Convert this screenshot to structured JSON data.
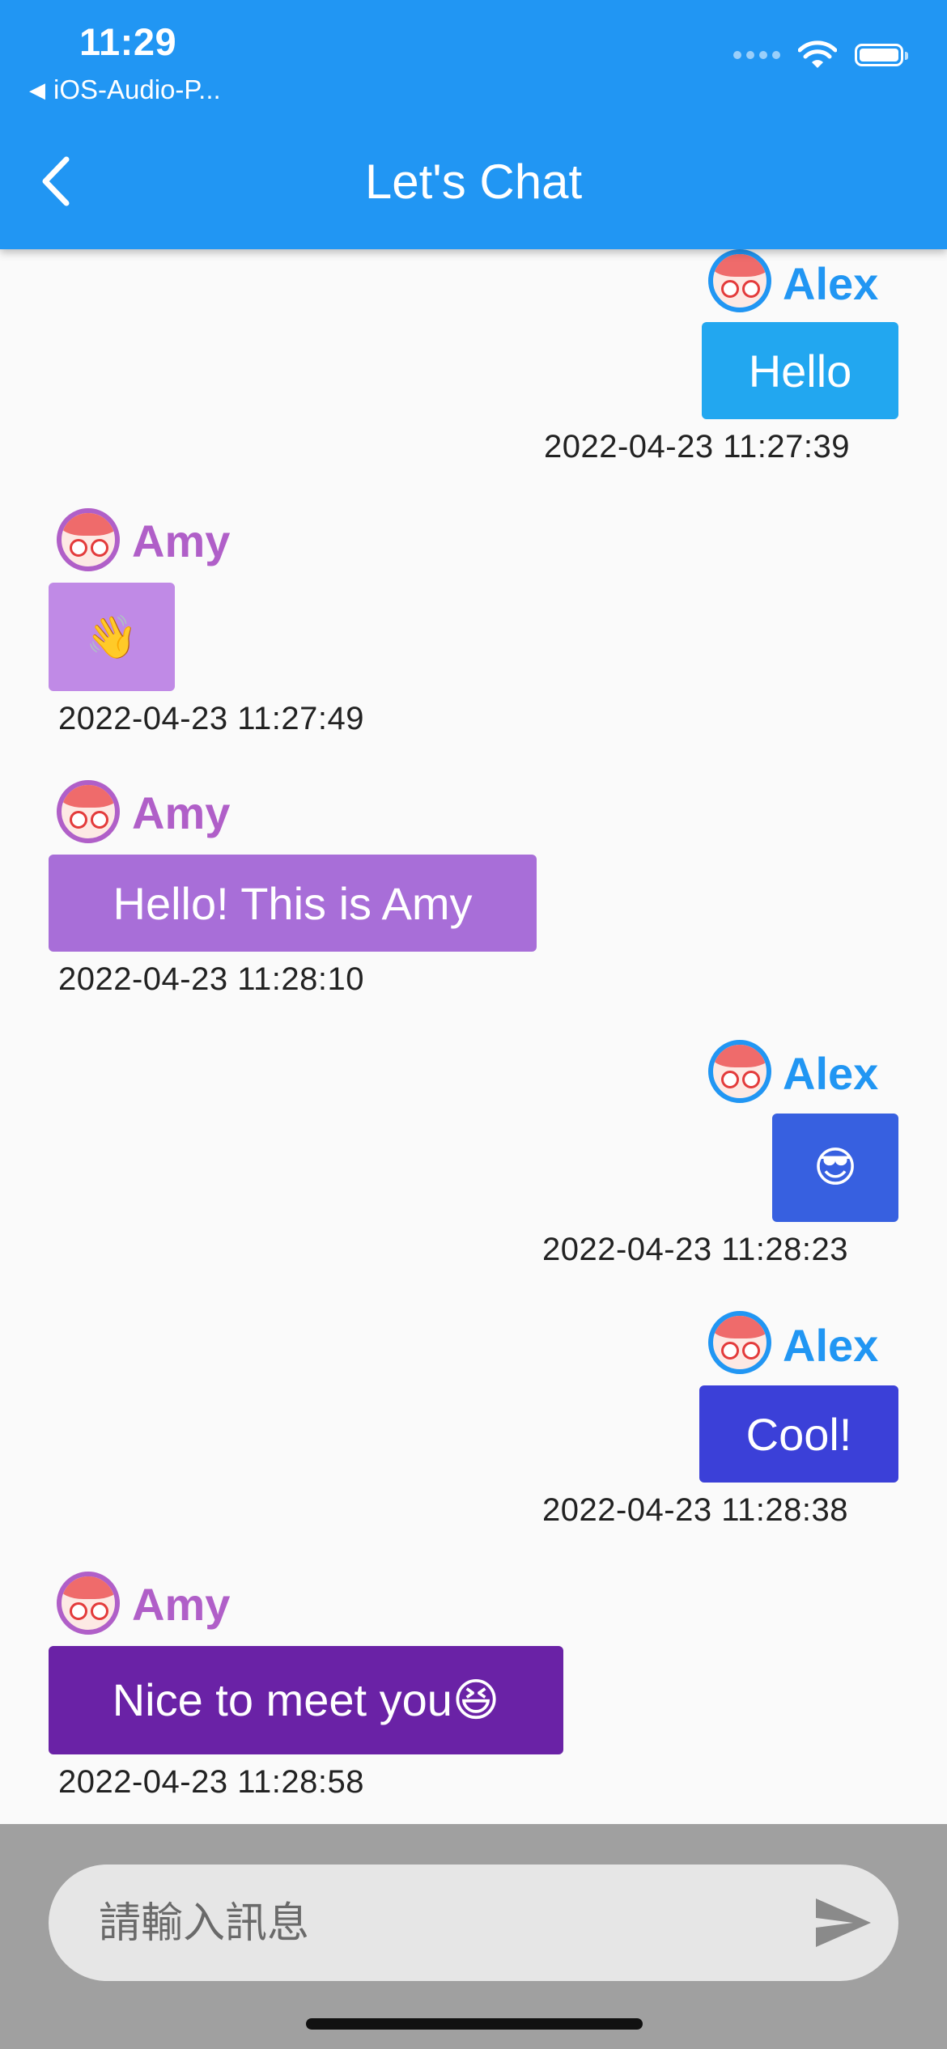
{
  "status_bar": {
    "time": "11:29",
    "back_app": "iOS-Audio-P..."
  },
  "header": {
    "title": "Let's Chat"
  },
  "colors": {
    "appbar": "#2196f3",
    "alex": "#2196f3",
    "amy": "#b05fc8"
  },
  "messages": [
    {
      "sender": "Alex",
      "text": "Hello",
      "timestamp": "2022-04-23 11:27:39",
      "bubble_color": "#22a7f0"
    },
    {
      "sender": "Amy",
      "text": "👋",
      "timestamp": "2022-04-23 11:27:49",
      "bubble_color": "#c08ae6"
    },
    {
      "sender": "Amy",
      "text": "Hello! This is Amy",
      "timestamp": "2022-04-23 11:28:10",
      "bubble_color": "#a86ed8"
    },
    {
      "sender": "Alex",
      "text": "😎",
      "timestamp": "2022-04-23 11:28:23",
      "bubble_color": "#3760e0"
    },
    {
      "sender": "Alex",
      "text": "Cool!",
      "timestamp": "2022-04-23 11:28:38",
      "bubble_color": "#3b40d8"
    },
    {
      "sender": "Amy",
      "text": "Nice to meet you😆",
      "timestamp": "2022-04-23 11:28:58",
      "bubble_color": "#6a22a6"
    }
  ],
  "input": {
    "placeholder": "請輸入訊息",
    "value": ""
  },
  "icons": {
    "back": "chevron-left-icon",
    "send": "send-icon",
    "wifi": "wifi-icon",
    "battery": "battery-icon",
    "avatar": "avatar-icon"
  }
}
